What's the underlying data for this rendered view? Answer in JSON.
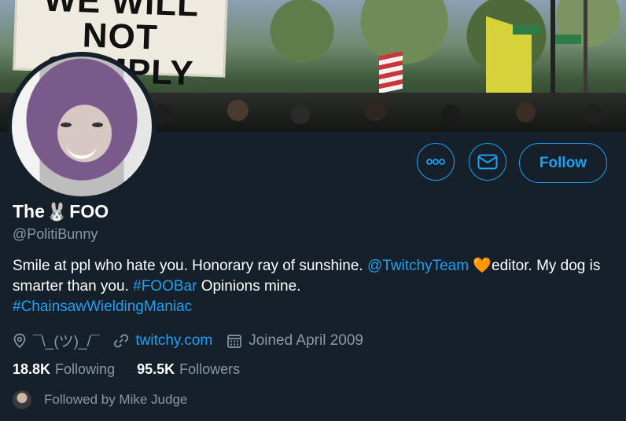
{
  "banner": {
    "sign_line1": "WE WILL",
    "sign_line2": "NOT COMPLY"
  },
  "actions": {
    "follow_label": "Follow"
  },
  "profile": {
    "name_part1": "The",
    "name_emoji": "🐰",
    "name_part2": "FOO",
    "handle": "@PolitiBunny"
  },
  "bio": {
    "text1": "Smile at ppl who hate you. Honorary ray of sunshine. ",
    "mention": "@TwitchyTeam",
    "heart": "🧡",
    "text2": "editor. My dog is smarter than you. ",
    "hashtag1": "#FOOBar",
    "text3": " Opinions mine.",
    "hashtag2": "#ChainsawWieldingManiac"
  },
  "meta": {
    "location": "¯\\_(ツ)_/¯",
    "website": "twitchy.com",
    "joined": "Joined April 2009"
  },
  "stats": {
    "following_count": "18.8K",
    "following_label": "Following",
    "followers_count": "95.5K",
    "followers_label": "Followers"
  },
  "followed_by": "Followed by Mike Judge",
  "colors": {
    "background": "#15202b",
    "accent": "#1da1f2",
    "muted": "#8899a6"
  }
}
